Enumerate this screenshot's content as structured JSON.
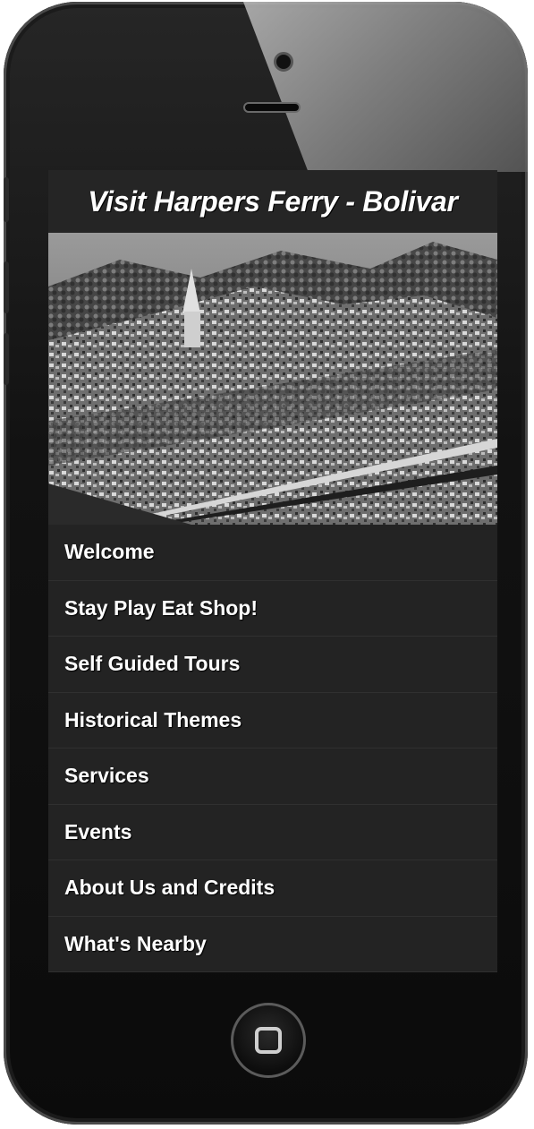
{
  "app": {
    "title": "Visit Harpers Ferry - Bolivar"
  },
  "hero": {
    "image": "aerial-town-photo"
  },
  "menu": {
    "items": [
      {
        "label": "Welcome"
      },
      {
        "label": "Stay Play Eat Shop!"
      },
      {
        "label": "Self Guided Tours"
      },
      {
        "label": "Historical Themes"
      },
      {
        "label": "Services"
      },
      {
        "label": "Events"
      },
      {
        "label": "About Us and Credits"
      },
      {
        "label": "What's Nearby"
      }
    ]
  },
  "device": {
    "home_button_icon": "home-square-icon"
  },
  "colors": {
    "screen_background": "#232323",
    "title_text": "#ffffff",
    "menu_text": "#ffffff"
  }
}
